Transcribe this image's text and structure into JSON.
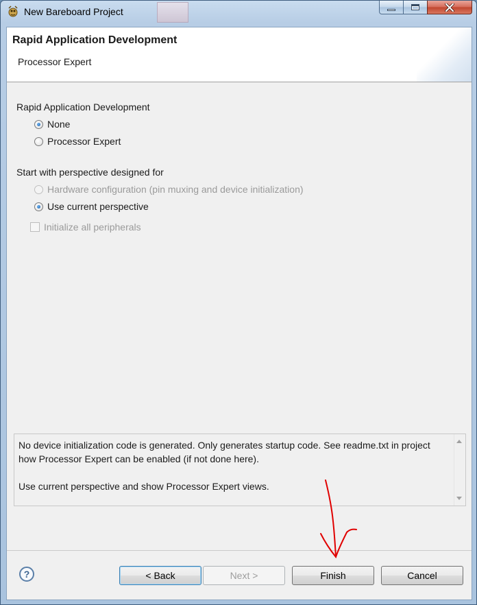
{
  "window": {
    "title": "New Bareboard Project",
    "controls": {
      "minimize": "minimize-icon",
      "maximize": "maximize-icon",
      "close": "close-icon"
    }
  },
  "header": {
    "title": "Rapid Application Development",
    "description": "Processor Expert"
  },
  "rad": {
    "label": "Rapid Application Development",
    "options": [
      {
        "label": "None",
        "checked": true,
        "enabled": true
      },
      {
        "label": "Processor Expert",
        "checked": false,
        "enabled": true
      }
    ]
  },
  "perspective": {
    "label": "Start with perspective designed for",
    "options": [
      {
        "label": "Hardware configuration (pin muxing and device initialization)",
        "checked": false,
        "enabled": false
      },
      {
        "label": "Use current perspective",
        "checked": true,
        "enabled": true
      }
    ],
    "init_checkbox": {
      "label": "Initialize all peripherals",
      "checked": false,
      "enabled": false
    }
  },
  "description_box": {
    "para1": "No device initialization code is generated. Only generates startup code. See readme.txt in project how Processor Expert can be enabled (if not done here).",
    "para2": "Use current perspective and show Processor Expert views."
  },
  "footer": {
    "help": "?",
    "back_label": "< Back",
    "next_label": "Next >",
    "finish_label": "Finish",
    "cancel_label": "Cancel"
  },
  "colors": {
    "annotation_arrow": "#e00000",
    "title_gradient": "#b7cde5",
    "close_button": "#c0452f"
  }
}
